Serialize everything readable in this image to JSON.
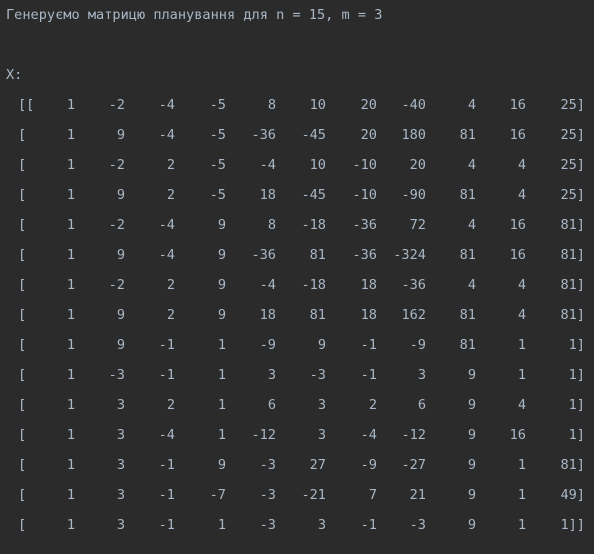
{
  "console": {
    "header": "Генеруємо матрицю планування для n = 15, m = 3",
    "x_label": "X:",
    "rows": [
      {
        "open": "[[",
        "values": [
          "1",
          "-2",
          "-4",
          "-5",
          "8",
          "10",
          "20",
          "-40",
          "4",
          "16",
          "25]"
        ]
      },
      {
        "open": "[",
        "values": [
          "1",
          "9",
          "-4",
          "-5",
          "-36",
          "-45",
          "20",
          "180",
          "81",
          "16",
          "25]"
        ]
      },
      {
        "open": "[",
        "values": [
          "1",
          "-2",
          "2",
          "-5",
          "-4",
          "10",
          "-10",
          "20",
          "4",
          "4",
          "25]"
        ]
      },
      {
        "open": "[",
        "values": [
          "1",
          "9",
          "2",
          "-5",
          "18",
          "-45",
          "-10",
          "-90",
          "81",
          "4",
          "25]"
        ]
      },
      {
        "open": "[",
        "values": [
          "1",
          "-2",
          "-4",
          "9",
          "8",
          "-18",
          "-36",
          "72",
          "4",
          "16",
          "81]"
        ]
      },
      {
        "open": "[",
        "values": [
          "1",
          "9",
          "-4",
          "9",
          "-36",
          "81",
          "-36",
          "-324",
          "81",
          "16",
          "81]"
        ]
      },
      {
        "open": "[",
        "values": [
          "1",
          "-2",
          "2",
          "9",
          "-4",
          "-18",
          "18",
          "-36",
          "4",
          "4",
          "81]"
        ]
      },
      {
        "open": "[",
        "values": [
          "1",
          "9",
          "2",
          "9",
          "18",
          "81",
          "18",
          "162",
          "81",
          "4",
          "81]"
        ]
      },
      {
        "open": "[",
        "values": [
          "1",
          "9",
          "-1",
          "1",
          "-9",
          "9",
          "-1",
          "-9",
          "81",
          "1",
          "1]"
        ]
      },
      {
        "open": "[",
        "values": [
          "1",
          "-3",
          "-1",
          "1",
          "3",
          "-3",
          "-1",
          "3",
          "9",
          "1",
          "1]"
        ]
      },
      {
        "open": "[",
        "values": [
          "1",
          "3",
          "2",
          "1",
          "6",
          "3",
          "2",
          "6",
          "9",
          "4",
          "1]"
        ]
      },
      {
        "open": "[",
        "values": [
          "1",
          "3",
          "-4",
          "1",
          "-12",
          "3",
          "-4",
          "-12",
          "9",
          "16",
          "1]"
        ]
      },
      {
        "open": "[",
        "values": [
          "1",
          "3",
          "-1",
          "9",
          "-3",
          "27",
          "-9",
          "-27",
          "9",
          "1",
          "81]"
        ]
      },
      {
        "open": "[",
        "values": [
          "1",
          "3",
          "-1",
          "-7",
          "-3",
          "-21",
          "7",
          "21",
          "9",
          "1",
          "49]"
        ]
      },
      {
        "open": "[",
        "values": [
          "1",
          "3",
          "-1",
          "1",
          "-3",
          "3",
          "-1",
          "-3",
          "9",
          "1",
          "1]]"
        ]
      }
    ]
  },
  "colors": {
    "background": "#2b2b2b",
    "text": "#a9b7c6"
  }
}
